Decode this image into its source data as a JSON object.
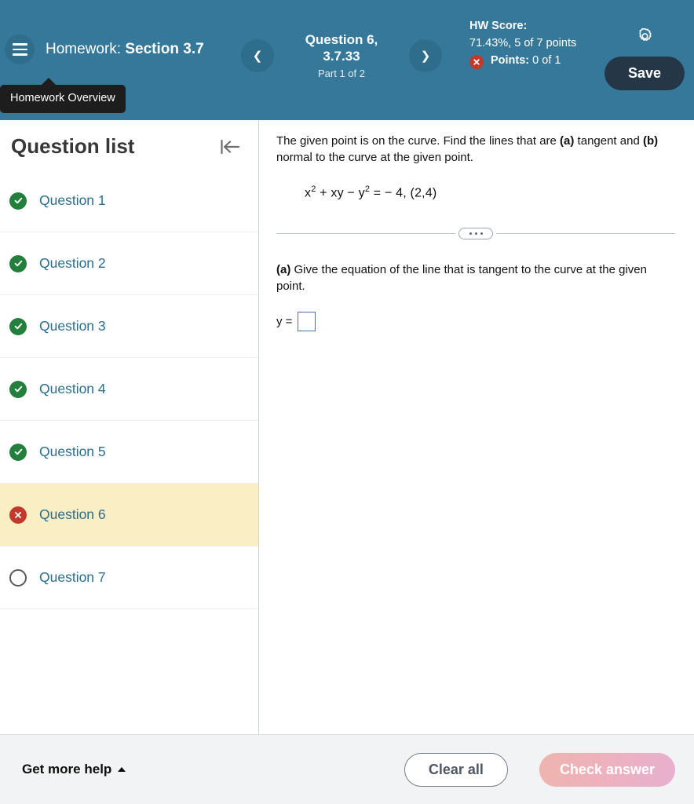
{
  "header": {
    "menu_tooltip": "Homework Overview",
    "hamburger_icon": "hamburger-menu-icon",
    "title_prefix": "Homework:",
    "title_main": "Section 3.7",
    "prev_icon": "chevron-left-icon",
    "next_icon": "chevron-right-icon",
    "question_title": "Question 6, 3.7.33",
    "part_label": "Part 1 of 2",
    "hw_score_label": "HW Score:",
    "hw_score_value": "71.43%, 5 of 7 points",
    "points_label": "Points:",
    "points_value": "0 of 1",
    "points_status_icon": "circle-x-icon",
    "gear_icon": "gear-icon",
    "save_label": "Save",
    "bg_color": "#36789a",
    "save_bg_color": "#253746"
  },
  "sidebar": {
    "title": "Question list",
    "collapse_icon": "collapse-left-icon",
    "items": [
      {
        "label": "Question 1",
        "status": "correct",
        "icon": "check-circle-icon",
        "current": false
      },
      {
        "label": "Question 2",
        "status": "correct",
        "icon": "check-circle-icon",
        "current": false
      },
      {
        "label": "Question 3",
        "status": "correct",
        "icon": "check-circle-icon",
        "current": false
      },
      {
        "label": "Question 4",
        "status": "correct",
        "icon": "check-circle-icon",
        "current": false
      },
      {
        "label": "Question 5",
        "status": "correct",
        "icon": "check-circle-icon",
        "current": false
      },
      {
        "label": "Question 6",
        "status": "incorrect",
        "icon": "circle-x-icon",
        "current": true
      },
      {
        "label": "Question 7",
        "status": "unanswered",
        "icon": "empty-circle-icon",
        "current": false
      }
    ],
    "link_color": "#2b6e8e",
    "current_bg_color": "#faeec4"
  },
  "main": {
    "prompt_part1": "The given point is on the curve. Find the lines that are ",
    "prompt_bold_a": "(a)",
    "prompt_part2": " tangent and ",
    "prompt_bold_b": "(b)",
    "prompt_part3": " normal to the curve at the given point.",
    "equation": {
      "base1": "x",
      "exp1": "2",
      "op1": " + xy − ",
      "base2": "y",
      "exp2": "2",
      "tail": " = − 4, (2,4)"
    },
    "ellipsis_icon": "ellipsis-expand-icon",
    "part_a_label": "(a)",
    "part_a_text": " Give the equation of the line that is tangent to the curve at the given point.",
    "answer_prefix": "y =",
    "answer_value": "",
    "answer_placeholder": ""
  },
  "footer": {
    "help_label": "Get more help",
    "help_caret_icon": "caret-up-icon",
    "clear_label": "Clear all",
    "check_label": "Check answer",
    "check_disabled": true,
    "bg_color": "#f2f3f4"
  }
}
